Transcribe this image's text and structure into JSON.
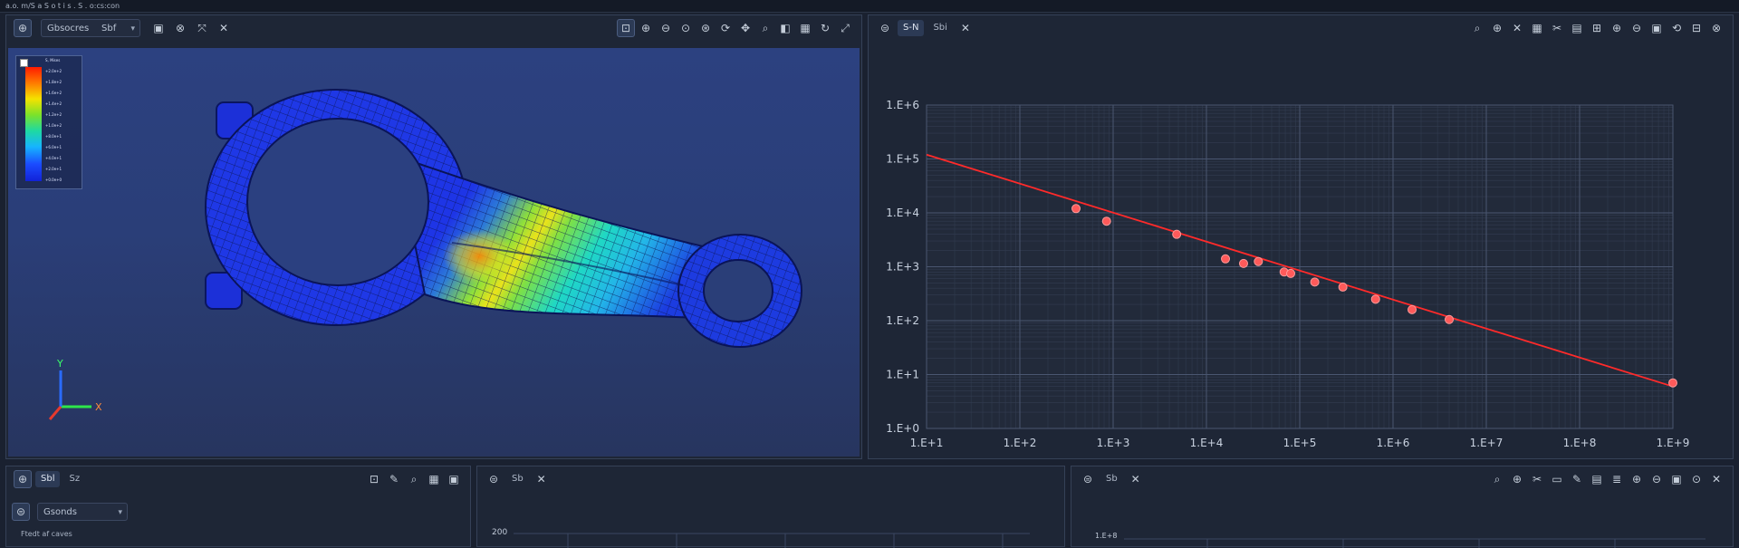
{
  "app": {
    "title": "a.o. m/S a S o t i s . S . o:cs:con"
  },
  "viewport": {
    "toolbar": {
      "view_combo": "Gbsocres",
      "view_extra": "Sbf",
      "right_icons": [
        "zoom-box-icon",
        "zoom-in-icon",
        "zoom-out-icon",
        "zoom-fit-icon",
        "zoom-select-icon",
        "rotate-icon",
        "pan-icon",
        "magnify-icon",
        "shade-icon",
        "mesh-icon",
        "refresh-icon",
        "close-icon"
      ]
    },
    "legend": {
      "labels": [
        "S, Mises",
        "+2.0e+2",
        "+1.8e+2",
        "+1.6e+2",
        "+1.4e+2",
        "+1.2e+2",
        "+1.0e+2",
        "+8.0e+1",
        "+6.0e+1",
        "+4.0e+1",
        "+2.0e+1",
        "+0.0e+0"
      ]
    },
    "triad": {
      "x": "X",
      "y": "Y"
    },
    "colors": {
      "hot": "#ff3b00",
      "warm": "#f4e200",
      "mid": "#20d6a6",
      "cool": "#1b3cff"
    }
  },
  "chart_panel": {
    "tabs": [
      "S-N",
      "Sbi"
    ],
    "right_icons": [
      "search-icon",
      "zoom-icon",
      "cross-icon",
      "grid-icon",
      "cut-icon",
      "table-icon",
      "axis-icon",
      "zoom-in-icon",
      "zoom-out-icon",
      "box-icon",
      "save-icon",
      "copy-icon",
      "close-icon"
    ]
  },
  "chart_data": {
    "type": "scatter",
    "xscale": "log",
    "yscale": "log",
    "xlim": [
      10,
      1000000000
    ],
    "ylim": [
      1,
      1000000
    ],
    "x_ticks": [
      "1.E+1",
      "1.E+2",
      "1.E+3",
      "1.E+4",
      "1.E+5",
      "1.E+6",
      "1.E+7",
      "1.E+8",
      "1.E+9"
    ],
    "y_ticks": [
      "1.E+0",
      "1.E+1",
      "1.E+2",
      "1.E+3",
      "1.E+4",
      "1.E+5",
      "1.E+6"
    ],
    "grid": true,
    "series": [
      {
        "points": [
          [
            400,
            12000
          ],
          [
            850,
            7000
          ],
          [
            4800,
            4000
          ],
          [
            16000,
            1400
          ],
          [
            25000,
            1150
          ],
          [
            36000,
            1250
          ],
          [
            68000,
            800
          ],
          [
            80000,
            750
          ],
          [
            145000,
            520
          ],
          [
            290000,
            420
          ],
          [
            650000,
            250
          ],
          [
            1600000,
            160
          ],
          [
            4000000,
            105
          ],
          [
            1000000000,
            7
          ]
        ],
        "color": "#ff5a5a"
      },
      {
        "line": [
          [
            10,
            120000
          ],
          [
            1000000000,
            6
          ]
        ],
        "color": "#ff2a2a"
      }
    ]
  },
  "bottom_left": {
    "tabs": [
      "Sbl",
      "Sz"
    ],
    "combo": "Gsonds",
    "label": "Ftedt af caves",
    "right_icons": [
      "zoom-box-icon",
      "edit-icon",
      "search-icon",
      "grid-icon",
      "frame-icon"
    ]
  },
  "bottom_mid": {
    "tabs": [
      "Sb"
    ],
    "y_tick": "200"
  },
  "bottom_right": {
    "tabs": [
      "Sb"
    ],
    "y_tick": "1.E+8",
    "right_icons": [
      "search-icon",
      "zoom-icon",
      "cut-icon",
      "camera-icon",
      "pen-icon",
      "table-icon",
      "layers-icon",
      "zoom-in-icon",
      "zoom-out-icon",
      "box-icon",
      "fit-icon",
      "close-icon"
    ]
  }
}
